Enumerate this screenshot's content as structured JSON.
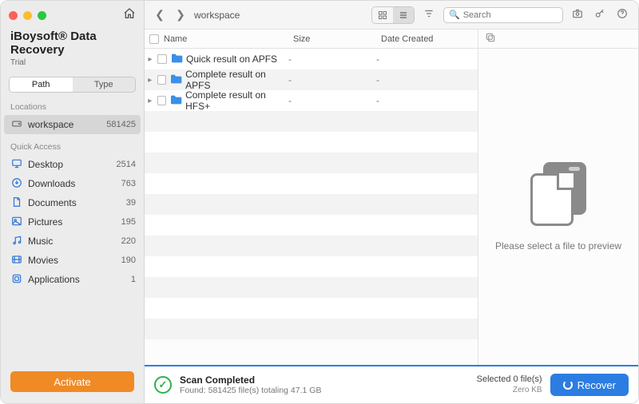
{
  "app": {
    "title": "iBoysoft® Data Recovery",
    "license": "Trial"
  },
  "sidebar": {
    "segmented": {
      "path": "Path",
      "type": "Type",
      "active": "path"
    },
    "locations_label": "Locations",
    "locations": [
      {
        "icon": "disk",
        "label": "workspace",
        "count": "581425",
        "selected": true
      }
    ],
    "quick_label": "Quick Access",
    "quick": [
      {
        "icon": "desktop",
        "label": "Desktop",
        "count": "2514"
      },
      {
        "icon": "download",
        "label": "Downloads",
        "count": "763"
      },
      {
        "icon": "document",
        "label": "Documents",
        "count": "39"
      },
      {
        "icon": "picture",
        "label": "Pictures",
        "count": "195"
      },
      {
        "icon": "music",
        "label": "Music",
        "count": "220"
      },
      {
        "icon": "movie",
        "label": "Movies",
        "count": "190"
      },
      {
        "icon": "app",
        "label": "Applications",
        "count": "1"
      }
    ],
    "activate": "Activate"
  },
  "toolbar": {
    "breadcrumb": "workspace",
    "search_placeholder": "Search"
  },
  "columns": {
    "name": "Name",
    "size": "Size",
    "date": "Date Created"
  },
  "rows": [
    {
      "name": "Quick result on APFS",
      "size": "-",
      "date": "-"
    },
    {
      "name": "Complete result on APFS",
      "size": "-",
      "date": "-"
    },
    {
      "name": "Complete result on HFS+",
      "size": "-",
      "date": "-"
    }
  ],
  "preview": {
    "placeholder": "Please select a file to preview"
  },
  "footer": {
    "status_title": "Scan Completed",
    "status_sub": "Found: 581425 file(s) totaling 47.1 GB",
    "selected_line1": "Selected 0 file(s)",
    "selected_line2": "Zero KB",
    "recover": "Recover"
  }
}
